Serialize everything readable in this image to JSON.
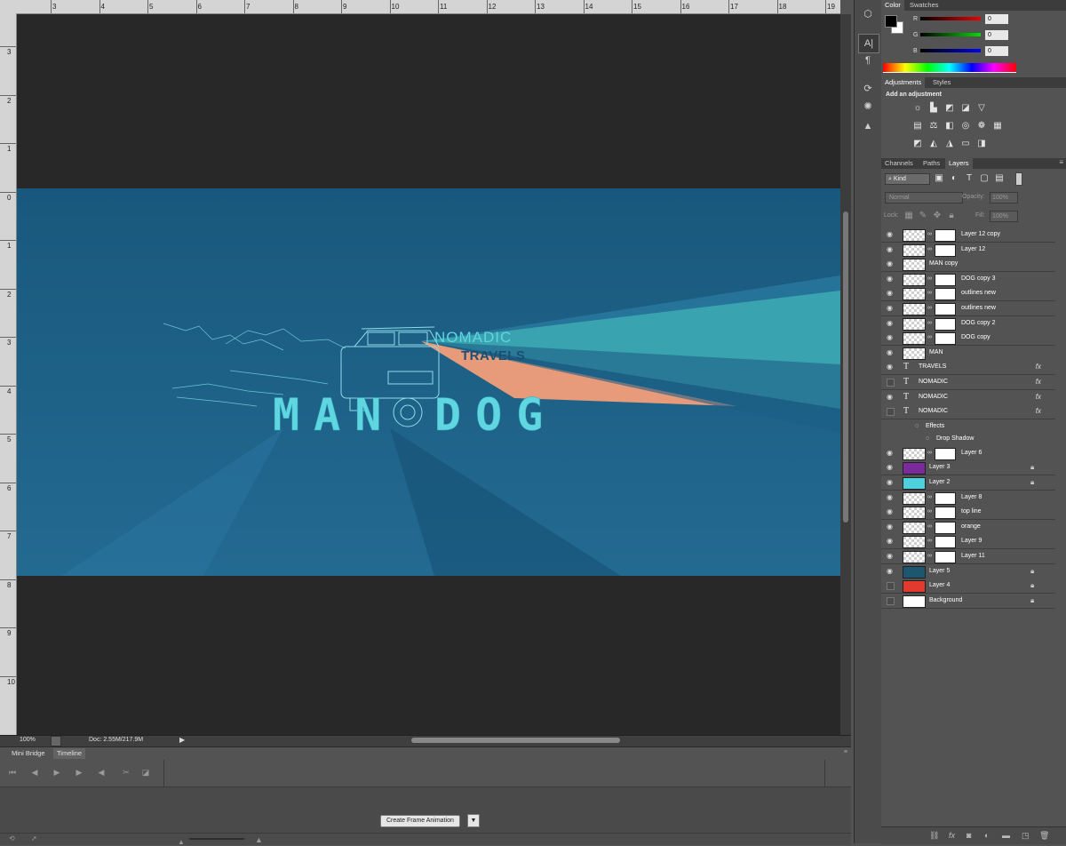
{
  "rulers": {
    "top_labels": [
      "3",
      "4",
      "5",
      "6",
      "7",
      "8",
      "9",
      "10",
      "11",
      "12",
      "13",
      "14",
      "15",
      "16",
      "17",
      "18",
      "19"
    ],
    "left_labels": [
      "3",
      "2",
      "1",
      "0",
      "1",
      "2",
      "3",
      "4",
      "5",
      "6",
      "7",
      "8",
      "9",
      "10"
    ]
  },
  "artwork": {
    "brand_top": "NOMADIC",
    "brand_bottom": "TRAVELS",
    "title_left": "MAN",
    "title_right": "DOG",
    "colors": {
      "bg": "#1e6289",
      "teal": "#3aa3b0",
      "orange": "#e89b7a",
      "title": "#5fd6e0"
    }
  },
  "status_bar": {
    "zoom": "100%",
    "doc": "Doc: 2.55M/217.9M"
  },
  "bottom_panel": {
    "tabs": [
      "Mini Bridge",
      "Timeline"
    ],
    "active_tab": "Timeline",
    "create_frame_label": "Create Frame Animation"
  },
  "color_panel": {
    "tabs": [
      "Color",
      "Swatches"
    ],
    "channels": [
      {
        "label": "R",
        "value": "0"
      },
      {
        "label": "G",
        "value": "0"
      },
      {
        "label": "B",
        "value": "0"
      }
    ]
  },
  "adjustments_panel": {
    "tabs": [
      "Adjustments",
      "Styles"
    ],
    "heading": "Add an adjustment"
  },
  "layers_panel": {
    "tabs": [
      "Channels",
      "Paths",
      "Layers"
    ],
    "filter_kind": "Kind",
    "blend_mode": "Normal",
    "opacity_label": "Opacity:",
    "opacity_value": "100%",
    "lock_label": "Lock:",
    "fill_label": "Fill:",
    "fill_value": "100%",
    "effects_label": "Effects",
    "drop_shadow_label": "Drop Shadow",
    "layers": [
      {
        "name": "Layer 12 copy",
        "visible": true,
        "kind": "masked"
      },
      {
        "name": "Layer 12",
        "visible": true,
        "kind": "masked"
      },
      {
        "name": "MAN copy",
        "visible": true,
        "kind": "pixel"
      },
      {
        "name": "DOG copy 3",
        "visible": true,
        "kind": "masked"
      },
      {
        "name": "outlines new",
        "visible": true,
        "kind": "masked"
      },
      {
        "name": "outlines new",
        "visible": true,
        "kind": "masked"
      },
      {
        "name": "DOG copy 2",
        "visible": true,
        "kind": "masked"
      },
      {
        "name": "DOG copy",
        "visible": true,
        "kind": "masked"
      },
      {
        "name": "MAN",
        "visible": true,
        "kind": "pixel"
      },
      {
        "name": "TRAVELS",
        "visible": true,
        "kind": "text",
        "fx": true
      },
      {
        "name": "NOMADIC",
        "visible": false,
        "kind": "text",
        "fx": true
      },
      {
        "name": "NOMADIC",
        "visible": true,
        "kind": "text",
        "fx": true
      },
      {
        "name": "NOMADIC",
        "visible": false,
        "kind": "text",
        "fx": true
      },
      {
        "name": "Layer 6",
        "visible": true,
        "kind": "masked"
      },
      {
        "name": "Layer 3",
        "visible": true,
        "kind": "fill",
        "color": "#7a2a9a",
        "locked": true
      },
      {
        "name": "Layer 2",
        "visible": true,
        "kind": "fill",
        "color": "#4fd0dc",
        "locked": true
      },
      {
        "name": "Layer 8",
        "visible": true,
        "kind": "masked"
      },
      {
        "name": "top line",
        "visible": true,
        "kind": "masked"
      },
      {
        "name": "orange",
        "visible": true,
        "kind": "masked"
      },
      {
        "name": "Layer 9",
        "visible": true,
        "kind": "masked"
      },
      {
        "name": "Layer 11",
        "visible": true,
        "kind": "masked"
      },
      {
        "name": "Layer 5",
        "visible": true,
        "kind": "fill",
        "color": "#1e5670",
        "locked": true
      },
      {
        "name": "Layer 4",
        "visible": false,
        "kind": "fill",
        "color": "#e23b2e",
        "locked": true
      },
      {
        "name": "Background",
        "visible": false,
        "kind": "fill",
        "color": "#ffffff",
        "locked": true
      }
    ]
  }
}
